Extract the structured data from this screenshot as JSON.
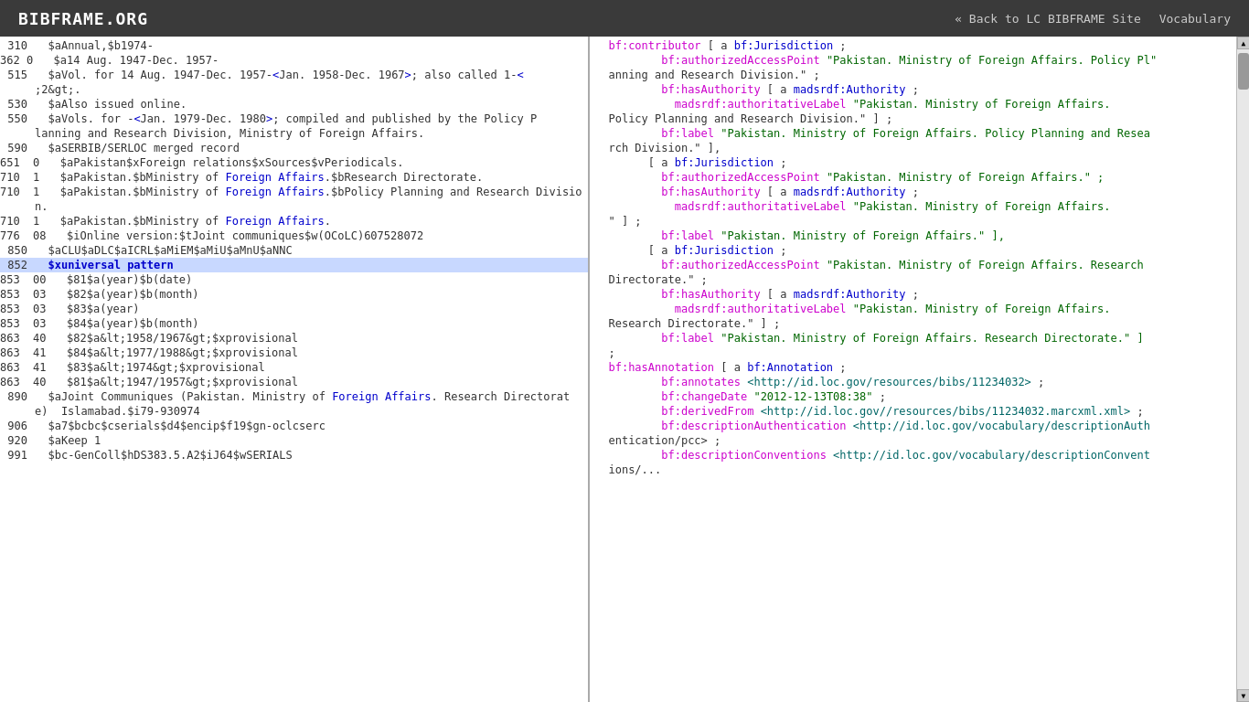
{
  "header": {
    "logo": "BIBFRAME.ORG",
    "nav": [
      {
        "label": "« Back to LC BIBFRAME Site",
        "id": "back-link"
      },
      {
        "label": "Vocabulary",
        "id": "vocab-link"
      }
    ]
  },
  "left_panel": {
    "lines": [
      {
        "num": "310",
        "content": "  $aAnnual,$b1974-",
        "highlight": false
      },
      {
        "num": "362 0",
        "content": "  $a14 Aug. 1947-Dec. 1957-",
        "highlight": false
      },
      {
        "num": "515",
        "content": "  $aVol. for 14 Aug. 1947-Dec. 1957-<span class='c-blue'>&lt;</span>Jan. 1958-Dec. 1967<span class='c-blue'>&gt;</span>; also called 1-<span class='c-blue'>&lt;</span>",
        "highlight": false,
        "raw": true
      },
      {
        "num": "",
        "content": ";2&gt;.",
        "highlight": false
      },
      {
        "num": "530",
        "content": "  $aAlso issued online.",
        "highlight": false
      },
      {
        "num": "550",
        "content": "  $aVols. for -<span class='c-blue'>&lt;</span>Jan. 1979-Dec. 1980<span class='c-blue'>&gt;</span>; compiled and published by the Policy P",
        "highlight": false,
        "raw": true
      },
      {
        "num": "",
        "content": "lanning and Research Division, Ministry of Foreign Affairs.",
        "highlight": false
      },
      {
        "num": "590",
        "content": "  $aSERBIB/SERLOC merged record",
        "highlight": false
      },
      {
        "num": "651  0",
        "content": "  $aPakistan$xForeign relations$xSources$vPeriodicals.",
        "highlight": false
      },
      {
        "num": "710  1",
        "content": "  $aPakistan.$bMinistry of <span class='c-blue'>Foreign Affairs</span>.$bResearch Directorate.",
        "highlight": false,
        "raw": true
      },
      {
        "num": "710  1",
        "content": "  $aPakistan.$bMinistry of <span class='c-blue'>Foreign Affairs</span>.$bPolicy Planning and Research Divisio",
        "highlight": false,
        "raw": true
      },
      {
        "num": "",
        "content": "n.",
        "highlight": false
      },
      {
        "num": "710  1",
        "content": "  $aPakistan.$bMinistry of <span class='c-blue'>Foreign Affairs</span>.",
        "highlight": false,
        "raw": true
      },
      {
        "num": "776  08",
        "content": "  $iOnline version:$tJoint communiques$w(OCoLC)607528072",
        "highlight": false
      },
      {
        "num": "850",
        "content": "  $aCLU$aDLC$aICRL$aMiEM$aMiU$aMnU$aNNC",
        "highlight": false
      },
      {
        "num": "852",
        "content": "  $xuniversal pattern",
        "highlight": true
      },
      {
        "num": "853  00",
        "content": "  $81$a(year)$b(date)",
        "highlight": false
      },
      {
        "num": "853  03",
        "content": "  $82$a(year)$b(month)",
        "highlight": false
      },
      {
        "num": "853  03",
        "content": "  $83$a(year)",
        "highlight": false
      },
      {
        "num": "853  03",
        "content": "  $84$a(year)$b(month)",
        "highlight": false
      },
      {
        "num": "863  40",
        "content": "  $82$a&lt;1958/1967&gt;$xprovisional",
        "highlight": false
      },
      {
        "num": "863  41",
        "content": "  $84$a&lt;1977/1988&gt;$xprovisional",
        "highlight": false
      },
      {
        "num": "863  41",
        "content": "  $83$a&lt;1974&gt;$xprovisional",
        "highlight": false
      },
      {
        "num": "863  40",
        "content": "  $81$a&lt;1947/1957&gt;$xprovisional",
        "highlight": false
      },
      {
        "num": "890",
        "content": "  $aJoint Communiques (Pakistan. Ministry of <span class='c-blue'>Foreign Affairs</span>. Research Directorat",
        "highlight": false,
        "raw": true
      },
      {
        "num": "",
        "content": "e)  Islamabad.$i79-930974",
        "highlight": false
      },
      {
        "num": "906",
        "content": "  $a7$bcbc$cserials$d4$encip$f19$gn-oclcserc",
        "highlight": false
      },
      {
        "num": "920",
        "content": "  $aKeep 1",
        "highlight": false
      },
      {
        "num": "991",
        "content": "  $bc-GenColl$hDS383.5.A2$iJ64$wSERIALS",
        "highlight": false
      }
    ]
  },
  "right_panel": {
    "lines": [
      {
        "content": "  <span class='c-magenta'>bf:contributor</span> [ a <span class='c-blue'>bf:Jurisdiction</span> ;"
      },
      {
        "content": "          <span class='c-magenta'>bf:authorizedAccessPoint</span> <span class='c-green'>\"Pakistan. Ministry of Foreign Affairs. Policy Pl\"</span>"
      },
      {
        "content": "  anning and Research Division.\" ;"
      },
      {
        "content": "          <span class='c-magenta'>bf:hasAuthority</span> [ a <span class='c-blue'>madsrdf:Authority</span> ;"
      },
      {
        "content": "            <span class='c-magenta'>madsrdf:authoritativeLabel</span> <span class='c-green'>\"Pakistan. Ministry of Foreign Affairs.</span>"
      },
      {
        "content": "  Policy Planning and Research Division.\" ] ;"
      },
      {
        "content": "          <span class='c-magenta'>bf:label</span> <span class='c-green'>\"Pakistan. Ministry of Foreign Affairs. Policy Planning and Resea</span>"
      },
      {
        "content": "  rch Division.\" ],"
      },
      {
        "content": "        [ a <span class='c-blue'>bf:Jurisdiction</span> ;"
      },
      {
        "content": "          <span class='c-magenta'>bf:authorizedAccessPoint</span> <span class='c-green'>\"Pakistan. Ministry of Foreign Affairs.\" ;</span>"
      },
      {
        "content": "          <span class='c-magenta'>bf:hasAuthority</span> [ a <span class='c-blue'>madsrdf:Authority</span> ;"
      },
      {
        "content": "            <span class='c-magenta'>madsrdf:authoritativeLabel</span> <span class='c-green'>\"Pakistan. Ministry of Foreign Affairs.</span>"
      },
      {
        "content": "  \" ] ;"
      },
      {
        "content": "          <span class='c-magenta'>bf:label</span> <span class='c-green'>\"Pakistan. Ministry of Foreign Affairs.\" ],</span>"
      },
      {
        "content": "        [ a <span class='c-blue'>bf:Jurisdiction</span> ;"
      },
      {
        "content": "          <span class='c-magenta'>bf:authorizedAccessPoint</span> <span class='c-green'>\"Pakistan. Ministry of Foreign Affairs. Research</span>"
      },
      {
        "content": "  Directorate.\" ;"
      },
      {
        "content": "          <span class='c-magenta'>bf:hasAuthority</span> [ a <span class='c-blue'>madsrdf:Authority</span> ;"
      },
      {
        "content": "            <span class='c-magenta'>madsrdf:authoritativeLabel</span> <span class='c-green'>\"Pakistan. Ministry of Foreign Affairs.</span>"
      },
      {
        "content": "  Research Directorate.\" ] ;"
      },
      {
        "content": "          <span class='c-magenta'>bf:label</span> <span class='c-green'>\"Pakistan. Ministry of Foreign Affairs. Research Directorate.\" ]</span>"
      },
      {
        "content": "  ;"
      },
      {
        "content": "  <span class='c-magenta'>bf:hasAnnotation</span> [ a <span class='c-blue'>bf:Annotation</span> ;"
      },
      {
        "content": "          <span class='c-magenta'>bf:annotates</span> <span class='c-teal'>&lt;http://id.loc.gov/resources/bibs/11234032&gt;</span> ;"
      },
      {
        "content": "          <span class='c-magenta'>bf:changeDate</span> <span class='c-green'>\"2012-12-13T08:38\"</span> ;"
      },
      {
        "content": "          <span class='c-magenta'>bf:derivedFrom</span> <span class='c-teal'>&lt;http://id.loc.gov//resources/bibs/11234032.marcxml.xml&gt;</span> ;"
      },
      {
        "content": "          <span class='c-magenta'>bf:descriptionAuthentication</span> <span class='c-teal'>&lt;http://id.loc.gov/vocabulary/descriptionAuth</span>"
      },
      {
        "content": "  entication/pcc&gt; ;"
      },
      {
        "content": "          <span class='c-magenta'>bf:descriptionConventions</span> <span class='c-teal'>&lt;http://id.loc.gov/vocabulary/descriptionConvent</span>"
      },
      {
        "content": "  ions/..."
      }
    ]
  }
}
